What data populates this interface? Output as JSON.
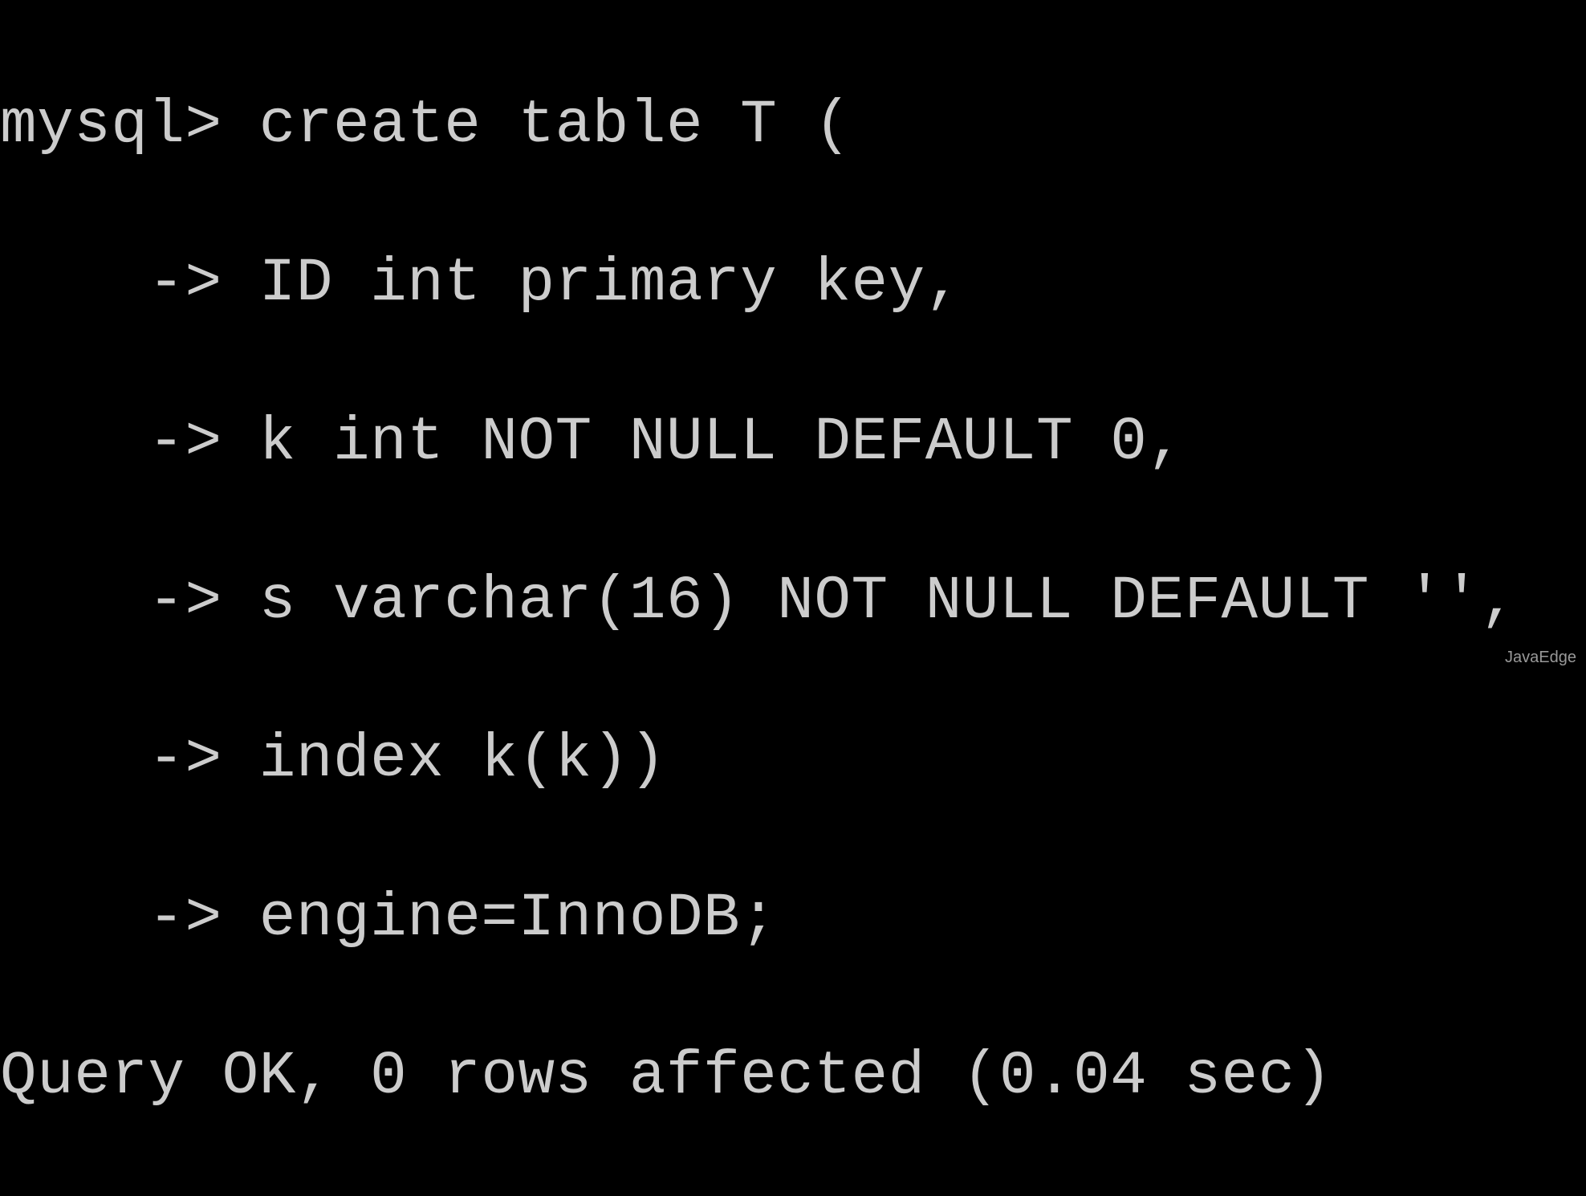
{
  "terminal": {
    "lines": [
      {
        "prompt": "mysql> ",
        "text": "create table T ("
      },
      {
        "prompt": "    -> ",
        "text": "ID int primary key,"
      },
      {
        "prompt": "    -> ",
        "text": "k int NOT NULL DEFAULT 0,"
      },
      {
        "prompt": "    -> ",
        "text": "s varchar(16) NOT NULL DEFAULT '',"
      },
      {
        "prompt": "    -> ",
        "text": "index k(k))"
      },
      {
        "prompt": "    -> ",
        "text": "engine=InnoDB;"
      }
    ],
    "result": "Query OK, 0 rows affected (0.04 sec)"
  },
  "watermark": "JavaEdge"
}
